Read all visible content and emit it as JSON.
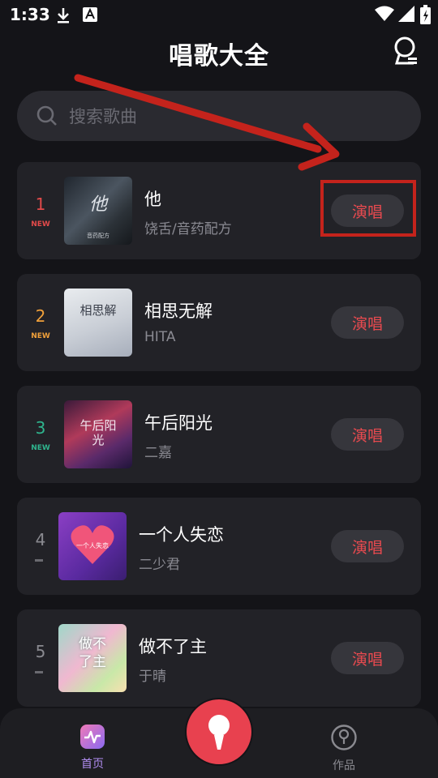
{
  "status_bar": {
    "time": "1:33"
  },
  "header": {
    "title": "唱歌大全"
  },
  "search": {
    "placeholder": "搜索歌曲"
  },
  "songs": [
    {
      "rank": "1",
      "badge": "NEW",
      "title": "他",
      "artist": "饶舌/音药配方",
      "cover_text": "他",
      "cover_sub": "音药配方",
      "sing_label": "演唱"
    },
    {
      "rank": "2",
      "badge": "NEW",
      "title": "相思无解",
      "artist": "HITA",
      "cover_text": "相思解",
      "cover_sub": "",
      "sing_label": "演唱"
    },
    {
      "rank": "3",
      "badge": "NEW",
      "title": "午后阳光",
      "artist": "二嘉",
      "cover_text": "午后阳光",
      "cover_sub": "",
      "sing_label": "演唱"
    },
    {
      "rank": "4",
      "badge": "",
      "title": "一个人失恋",
      "artist": "二少君",
      "cover_text": "一个人失恋",
      "cover_sub": "",
      "sing_label": "演唱"
    },
    {
      "rank": "5",
      "badge": "",
      "title": "做不了主",
      "artist": "于晴",
      "cover_text": "做不了主",
      "cover_sub": "",
      "sing_label": "演唱"
    }
  ],
  "bottom_nav": {
    "home_label": "首页",
    "works_label": "作品"
  },
  "colors": {
    "background": "#141418",
    "card": "#222227",
    "accent": "#e84a4f",
    "annotation": "#c4231c",
    "rank1": "#e24a4a",
    "rank2": "#f0a03a",
    "rank3": "#2fb58e",
    "rank_other": "#8a8a90"
  },
  "icons": [
    "download-icon",
    "app-notification-icon",
    "wifi-icon",
    "signal-icon",
    "battery-icon",
    "profile-icon",
    "search-icon",
    "home-icon",
    "microphone-icon",
    "works-icon"
  ]
}
